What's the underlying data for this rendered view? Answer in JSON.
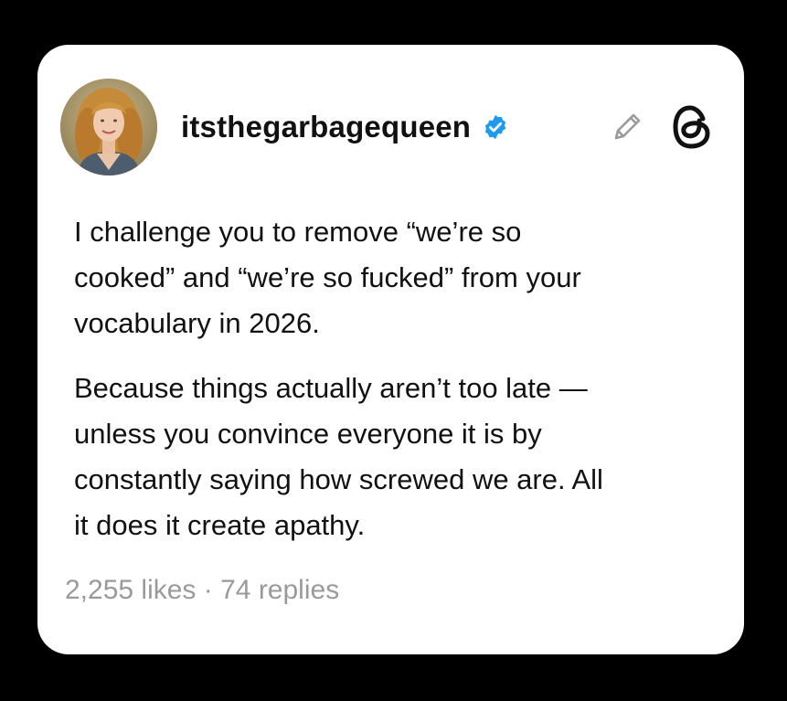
{
  "post": {
    "username": "itsthegarbagequeen",
    "verified": true,
    "paragraphs": [
      "I challenge you to remove “we’re so\ncooked” and “we’re so fucked” from your\nvocabulary in 2026.",
      "Because things actually aren’t too late —\nunless you convince everyone it is by\nconstantly saying how screwed we are. All\nit does it create apathy."
    ],
    "likes": "2,255 likes",
    "separator": " · ",
    "replies": "74 replies"
  },
  "icons": {
    "verified": "verified-badge-icon",
    "edit": "pencil-icon",
    "app_logo": "threads-logo-icon"
  },
  "colors": {
    "background": "#000000",
    "card": "#ffffff",
    "text": "#111111",
    "muted": "#9a9a9a",
    "verified": "#1d9bf0"
  }
}
